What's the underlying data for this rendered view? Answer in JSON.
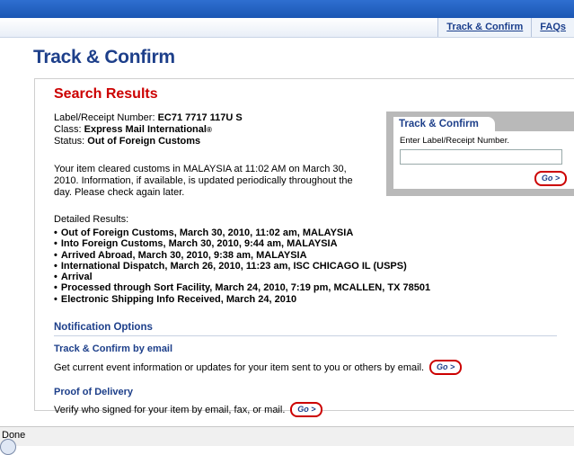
{
  "nav": {
    "track_confirm": "Track & Confirm",
    "faqs": "FAQs"
  },
  "page": {
    "title": "Track & Confirm"
  },
  "search_results": {
    "title": "Search Results",
    "label_receipt_prefix": "Label/Receipt Number: ",
    "label_receipt_value": "EC71 7717 117U S",
    "class_prefix": "Class: ",
    "class_value": "Express Mail International",
    "class_symbol": "®",
    "status_prefix": "Status: ",
    "status_value": "Out of Foreign Customs",
    "cleared_message": "Your item cleared customs in MALAYSIA at 11:02 AM on March 30, 2010. Information, if available, is updated periodically throughout the day. Please check again later.",
    "detailed_label": "Detailed Results:",
    "results": [
      "Out of Foreign Customs, March 30, 2010, 11:02 am, MALAYSIA",
      "Into Foreign Customs, March 30, 2010, 9:44 am, MALAYSIA",
      "Arrived Abroad, March 30, 2010, 9:38 am, MALAYSIA",
      "International Dispatch, March 26, 2010, 11:23 am, ISC CHICAGO IL (USPS)",
      "Arrival",
      "Processed through Sort Facility, March 24, 2010, 7:19 pm, MCALLEN, TX 78501",
      "Electronic Shipping Info Received, March 24, 2010"
    ]
  },
  "notification": {
    "title": "Notification Options",
    "email_title": "Track & Confirm by email",
    "email_desc": "Get current event information or updates for your item sent to you or others by email.",
    "pod_title": "Proof of Delivery",
    "pod_desc": "Verify who signed for your item by email, fax, or mail."
  },
  "widget": {
    "tab_label": "Track & Confirm",
    "input_label": "Enter Label/Receipt Number.",
    "input_value": ""
  },
  "go_label": "Go >",
  "status_bar": {
    "text": "Done"
  }
}
